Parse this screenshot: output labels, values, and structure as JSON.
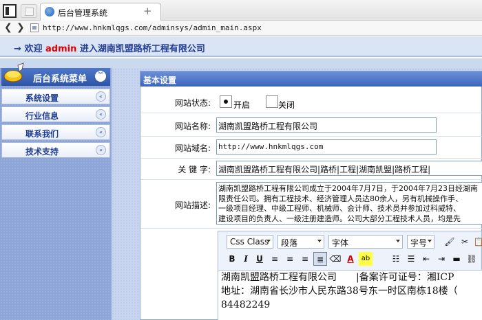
{
  "browser": {
    "tab_title": "后台管理系统",
    "tab_close": "×",
    "new_tab": "+",
    "back": "❮",
    "forward": "❯",
    "url": "http://www.hnkmlqgs.com/adminsys/admin_main.aspx"
  },
  "header": {
    "arrow": "→",
    "welcome_prefix": "欢迎",
    "username": "admin",
    "welcome_suffix": "进入湖南凯盟路桥工程有限公司"
  },
  "sidebar": {
    "title": "后台系统菜单",
    "collapse_glyph": "«",
    "items": [
      {
        "label": "系统设置"
      },
      {
        "label": "行业信息"
      },
      {
        "label": "联系我们"
      },
      {
        "label": "技术支持"
      }
    ]
  },
  "main": {
    "panel_title": "基本设置",
    "status": {
      "label": "网站状态:",
      "options": [
        {
          "label": "开启",
          "checked": true
        },
        {
          "label": "关闭",
          "checked": false
        }
      ]
    },
    "site_name": {
      "label": "网站名称:",
      "value": "湖南凯盟路桥工程有限公司"
    },
    "site_domain": {
      "label": "网站域名:",
      "value": "http://www.hnkmlqgs.com"
    },
    "keywords": {
      "label": "关 键 字:",
      "value": "湖南凯盟路桥工程有限公司|路桥|工程|湖南凯盟|路桥工程|"
    },
    "description": {
      "label": "网站描述:",
      "lines": [
        "湖南凯盟路桥工程有限公司成立于2004年7月7日，于2004年7月23日经湖南",
        "限责任公司。拥有工程技术、经济管理人员达80余人，另有机械操作手、",
        "一级项目经理、中级工程师、机械师、会计师、技术员并参加过科威特、",
        "建设项目的负责人、一级注册建造师。公司大部分工程技术人员，均是先"
      ]
    },
    "editor": {
      "css_class": "Css Class",
      "paragraph": "段落",
      "font": "字体",
      "font_size": "字号",
      "bold": "B",
      "italic": "I",
      "underline": "U",
      "content_lines": [
        "湖南凯盟路桥工程有限公司　　|备案许可证号：湘ICP",
        "地址：湖南省长沙市人民东路38号东一时区南栋18楼（",
        "84482249"
      ]
    }
  },
  "colors": {
    "accent": "#2c55a8",
    "header_text": "#243e92",
    "username": "#e00000"
  }
}
